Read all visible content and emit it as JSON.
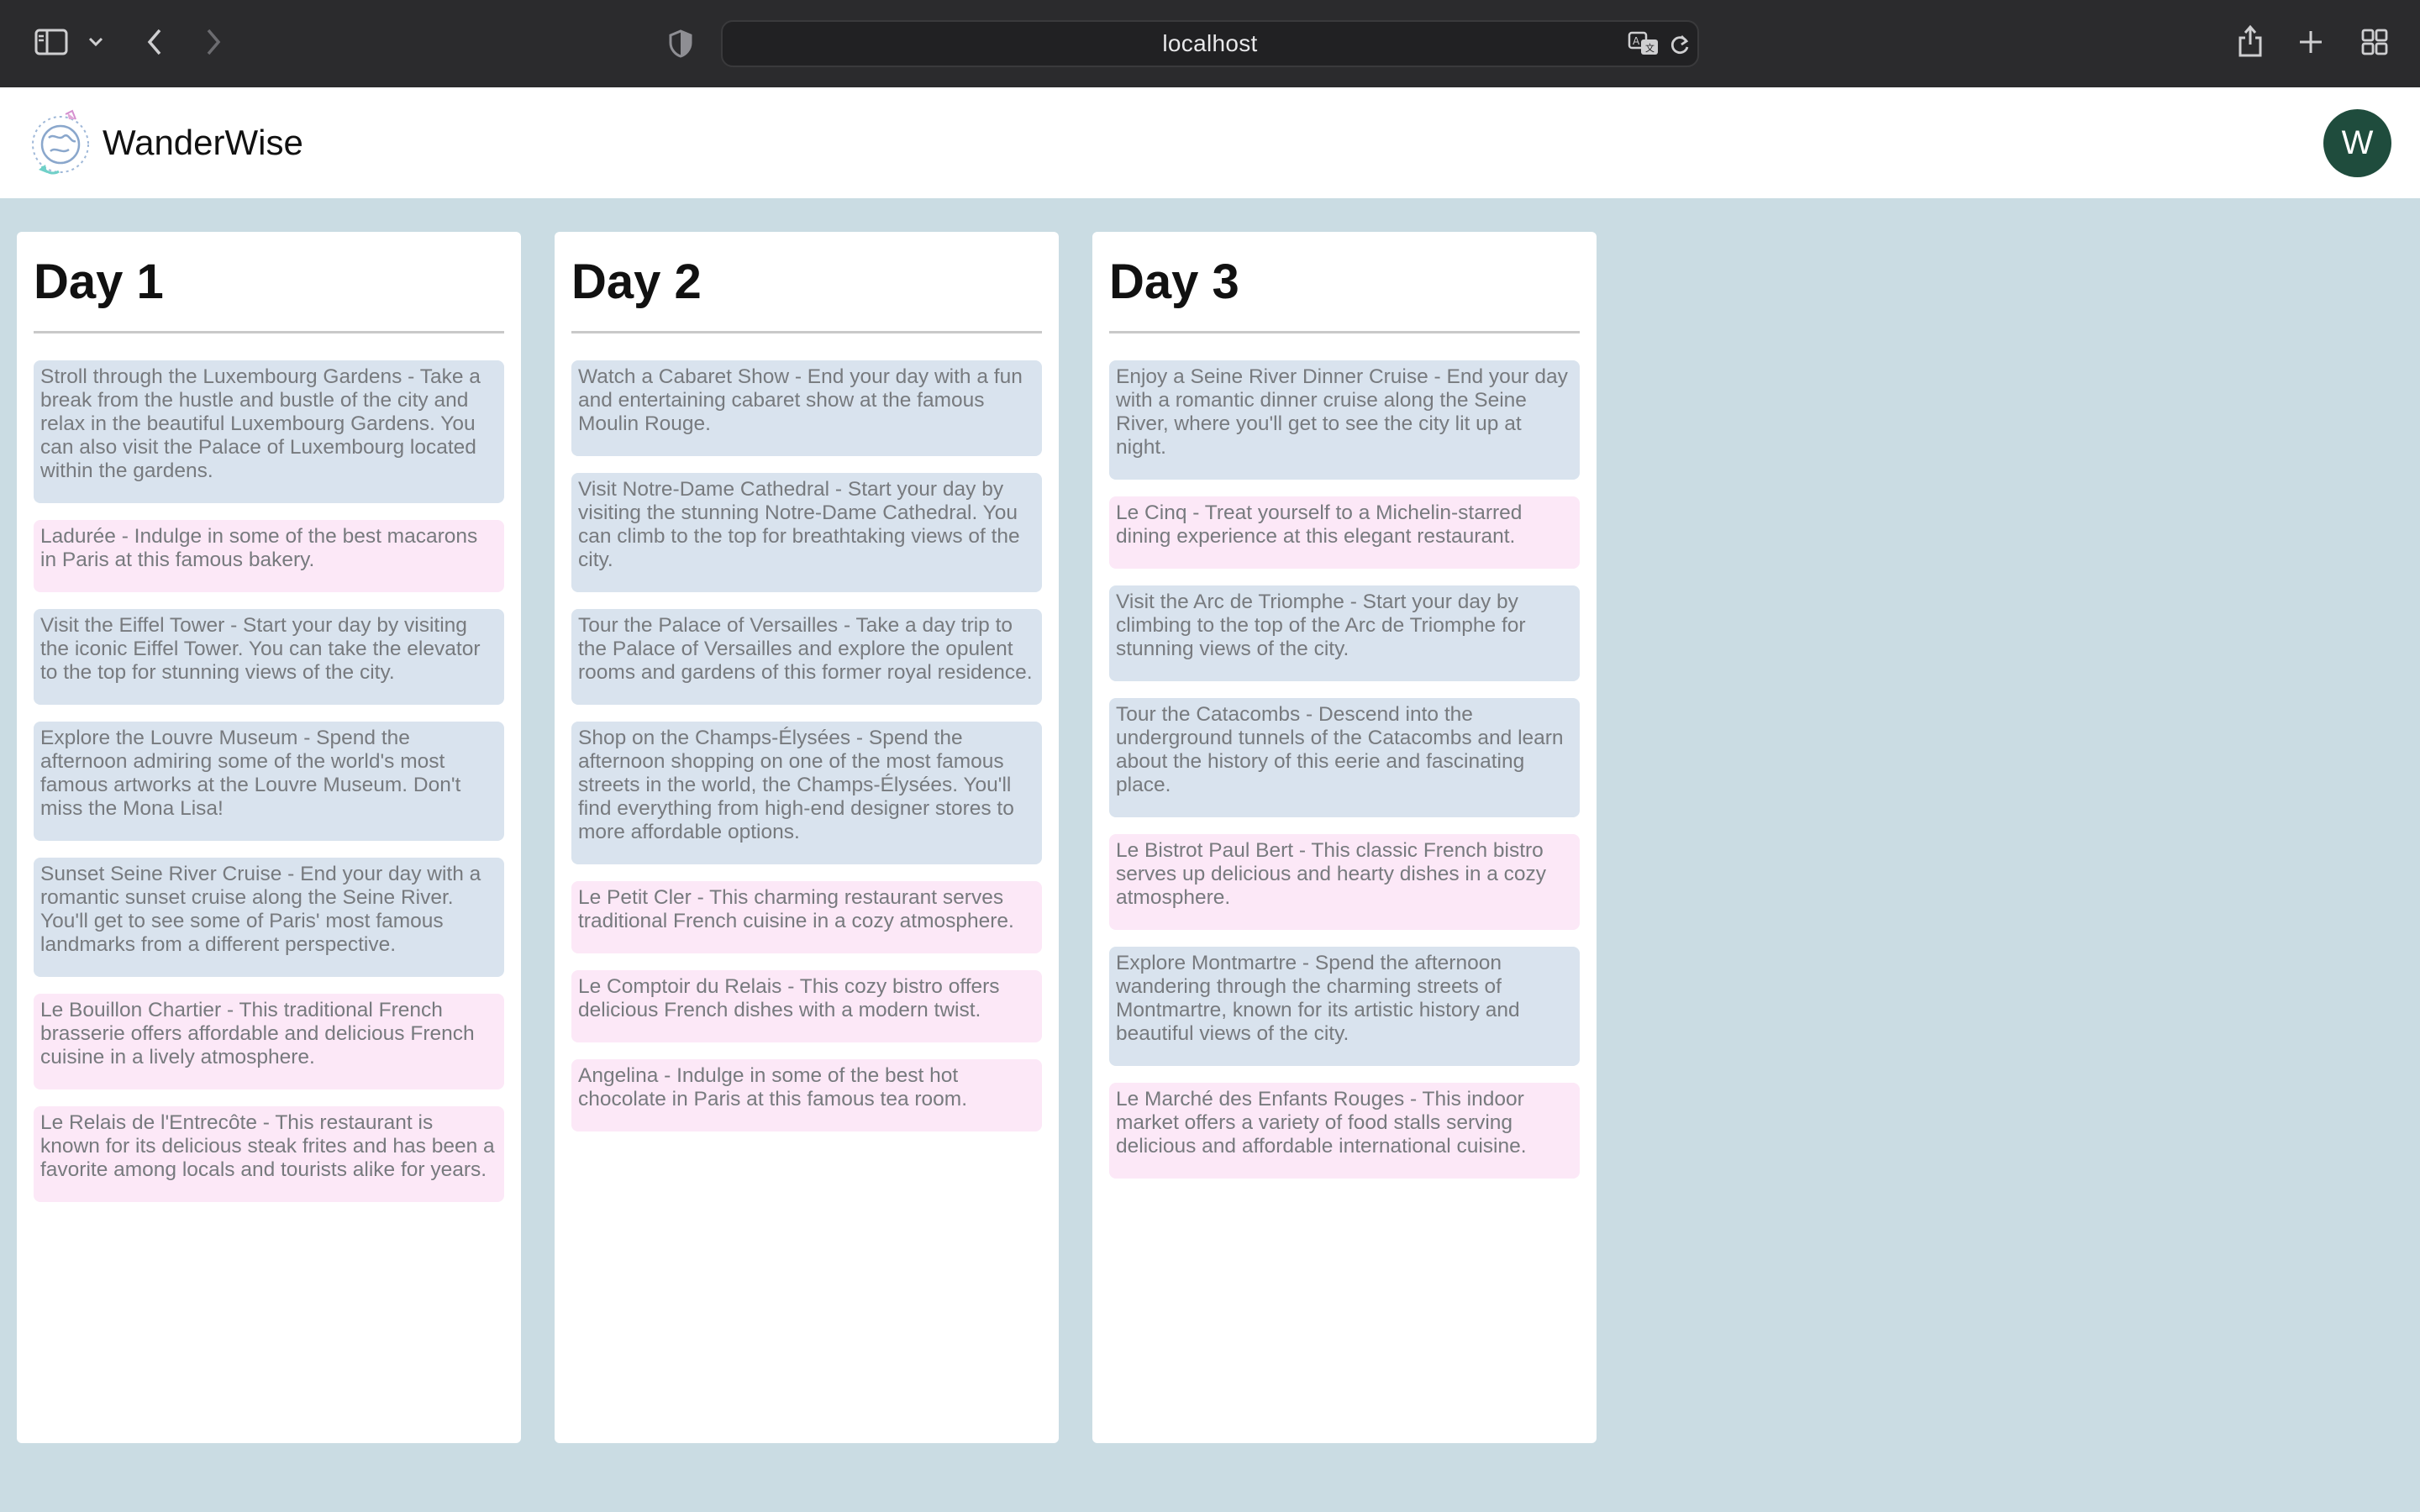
{
  "browser": {
    "url": "localhost"
  },
  "app": {
    "brand": "WanderWise",
    "avatar_initial": "W"
  },
  "days": [
    {
      "title": "Day 1",
      "items": [
        {
          "type": "activity",
          "text": "Stroll through the Luxembourg Gardens - Take a break from the hustle and bustle of the city and relax in the beautiful Luxembourg Gardens. You can also visit the Palace of Luxembourg located within the gardens."
        },
        {
          "type": "food",
          "text": "Ladurée - Indulge in some of the best macarons in Paris at this famous bakery."
        },
        {
          "type": "activity",
          "text": "Visit the Eiffel Tower - Start your day by visiting the iconic Eiffel Tower. You can take the elevator to the top for stunning views of the city."
        },
        {
          "type": "activity",
          "text": "Explore the Louvre Museum - Spend the afternoon admiring some of the world's most famous artworks at the Louvre Museum. Don't miss the Mona Lisa!"
        },
        {
          "type": "activity",
          "text": "Sunset Seine River Cruise - End your day with a romantic sunset cruise along the Seine River. You'll get to see some of Paris' most famous landmarks from a different perspective."
        },
        {
          "type": "food",
          "text": "Le Bouillon Chartier - This traditional French brasserie offers affordable and delicious French cuisine in a lively atmosphere."
        },
        {
          "type": "food",
          "text": "Le Relais de l'Entrecôte - This restaurant is known for its delicious steak frites and has been a favorite among locals and tourists alike for years."
        }
      ]
    },
    {
      "title": "Day 2",
      "items": [
        {
          "type": "activity",
          "text": "Watch a Cabaret Show - End your day with a fun and entertaining cabaret show at the famous Moulin Rouge."
        },
        {
          "type": "activity",
          "text": "Visit Notre-Dame Cathedral - Start your day by visiting the stunning Notre-Dame Cathedral. You can climb to the top for breathtaking views of the city."
        },
        {
          "type": "activity",
          "text": "Tour the Palace of Versailles - Take a day trip to the Palace of Versailles and explore the opulent rooms and gardens of this former royal residence."
        },
        {
          "type": "activity",
          "text": "Shop on the Champs-Élysées - Spend the afternoon shopping on one of the most famous streets in the world, the Champs-Élysées. You'll find everything from high-end designer stores to more affordable options."
        },
        {
          "type": "food",
          "text": "Le Petit Cler - This charming restaurant serves traditional French cuisine in a cozy atmosphere."
        },
        {
          "type": "food",
          "text": "Le Comptoir du Relais - This cozy bistro offers delicious French dishes with a modern twist."
        },
        {
          "type": "food",
          "text": "Angelina - Indulge in some of the best hot chocolate in Paris at this famous tea room."
        }
      ]
    },
    {
      "title": "Day 3",
      "items": [
        {
          "type": "activity",
          "text": "Enjoy a Seine River Dinner Cruise - End your day with a romantic dinner cruise along the Seine River, where you'll get to see the city lit up at night."
        },
        {
          "type": "food",
          "text": "Le Cinq - Treat yourself to a Michelin-starred dining experience at this elegant restaurant."
        },
        {
          "type": "activity",
          "text": "Visit the Arc de Triomphe - Start your day by climbing to the top of the Arc de Triomphe for stunning views of the city."
        },
        {
          "type": "activity",
          "text": "Tour the Catacombs - Descend into the underground tunnels of the Catacombs and learn about the history of this eerie and fascinating place."
        },
        {
          "type": "food",
          "text": "Le Bistrot Paul Bert - This classic French bistro serves up delicious and hearty dishes in a cozy atmosphere."
        },
        {
          "type": "activity",
          "text": "Explore Montmartre - Spend the afternoon wandering through the charming streets of Montmartre, known for its artistic history and beautiful views of the city."
        },
        {
          "type": "food",
          "text": "Le Marché des Enfants Rouges - This indoor market offers a variety of food stalls serving delicious and affordable international cuisine."
        }
      ]
    }
  ],
  "colors": {
    "activity_card": "#d9e3ee",
    "food_card": "#fce8f7",
    "page_background": "#cadce3",
    "avatar": "#1f4c3d"
  }
}
